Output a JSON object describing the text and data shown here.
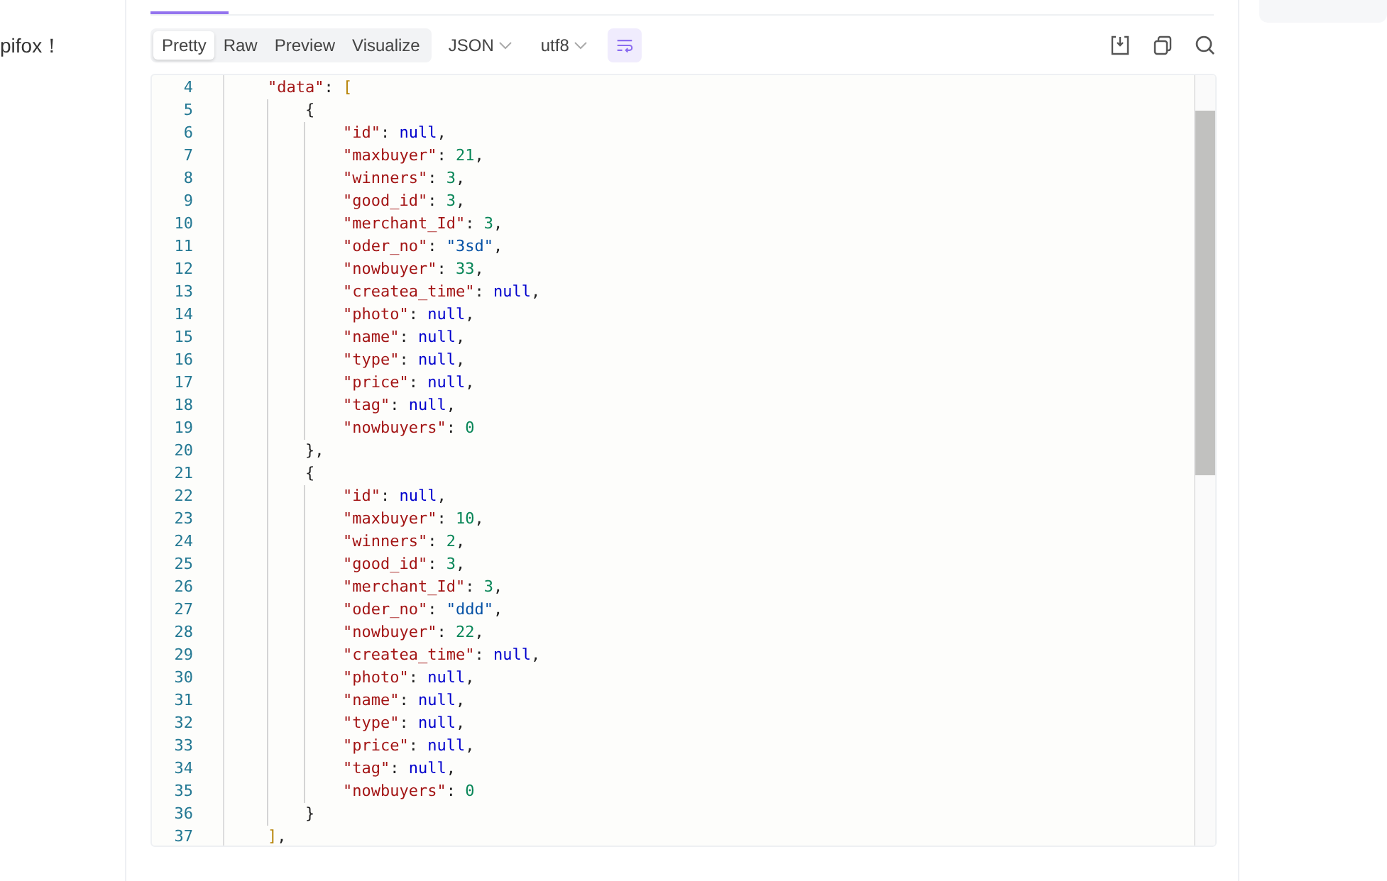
{
  "sidebar": {
    "text": "pifox！"
  },
  "response": {
    "view_tabs": [
      {
        "label": "Pretty",
        "selected": true
      },
      {
        "label": "Raw",
        "selected": false
      },
      {
        "label": "Preview",
        "selected": false
      },
      {
        "label": "Visualize",
        "selected": false
      }
    ],
    "format_dropdown": {
      "value": "JSON"
    },
    "encoding_dropdown": {
      "value": "utf8"
    },
    "wrap_toggle": {
      "on": true
    },
    "code": {
      "lines": [
        {
          "number": "4",
          "text": "    \"data\": ["
        },
        {
          "number": "5",
          "text": "        {"
        },
        {
          "number": "6",
          "text": "            \"id\": null,"
        },
        {
          "number": "7",
          "text": "            \"maxbuyer\": 21,"
        },
        {
          "number": "8",
          "text": "            \"winners\": 3,"
        },
        {
          "number": "9",
          "text": "            \"good_id\": 3,"
        },
        {
          "number": "10",
          "text": "            \"merchant_Id\": 3,"
        },
        {
          "number": "11",
          "text": "            \"oder_no\": \"3sd\","
        },
        {
          "number": "12",
          "text": "            \"nowbuyer\": 33,"
        },
        {
          "number": "13",
          "text": "            \"createa_time\": null,"
        },
        {
          "number": "14",
          "text": "            \"photo\": null,"
        },
        {
          "number": "15",
          "text": "            \"name\": null,"
        },
        {
          "number": "16",
          "text": "            \"type\": null,"
        },
        {
          "number": "17",
          "text": "            \"price\": null,"
        },
        {
          "number": "18",
          "text": "            \"tag\": null,"
        },
        {
          "number": "19",
          "text": "            \"nowbuyers\": 0"
        },
        {
          "number": "20",
          "text": "        },"
        },
        {
          "number": "21",
          "text": "        {"
        },
        {
          "number": "22",
          "text": "            \"id\": null,"
        },
        {
          "number": "23",
          "text": "            \"maxbuyer\": 10,"
        },
        {
          "number": "24",
          "text": "            \"winners\": 2,"
        },
        {
          "number": "25",
          "text": "            \"good_id\": 3,"
        },
        {
          "number": "26",
          "text": "            \"merchant_Id\": 3,"
        },
        {
          "number": "27",
          "text": "            \"oder_no\": \"ddd\","
        },
        {
          "number": "28",
          "text": "            \"nowbuyer\": 22,"
        },
        {
          "number": "29",
          "text": "            \"createa_time\": null,"
        },
        {
          "number": "30",
          "text": "            \"photo\": null,"
        },
        {
          "number": "31",
          "text": "            \"name\": null,"
        },
        {
          "number": "32",
          "text": "            \"type\": null,"
        },
        {
          "number": "33",
          "text": "            \"price\": null,"
        },
        {
          "number": "34",
          "text": "            \"tag\": null,"
        },
        {
          "number": "35",
          "text": "            \"nowbuyers\": 0"
        },
        {
          "number": "36",
          "text": "        }"
        },
        {
          "number": "37",
          "text": "    ],"
        }
      ]
    }
  }
}
